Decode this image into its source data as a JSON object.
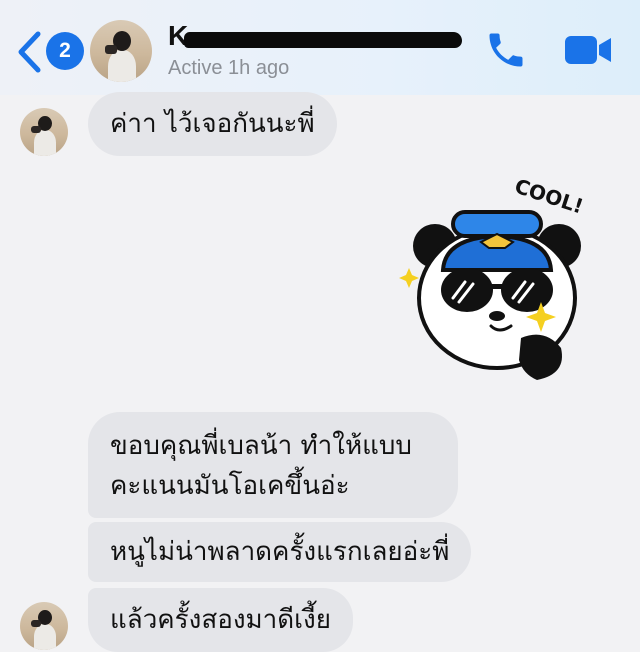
{
  "header": {
    "back_badge_count": "2",
    "contact_initial": "K",
    "status": "Active 1h ago"
  },
  "colors": {
    "accent": "#1a73e8",
    "bubble": "#e4e5e9",
    "background": "#f2f2f4",
    "status_text": "#8b8f96"
  },
  "icons": {
    "back": "chevron-left-icon",
    "call": "phone-icon",
    "video": "video-camera-icon",
    "sticker": "panda-sticker"
  },
  "sticker": {
    "caption": "COOL!"
  },
  "messages": [
    {
      "text": "ค่าา ไว้เจอกันนะพี่"
    },
    {
      "lines": [
        "ขอบคุณพี่เบลน้า  ทำให้แบบ",
        "คะแนนมันโอเคขึ้นอ่ะ"
      ]
    },
    {
      "text": "หนูไม่น่าพลาดครั้งแรกเลยอ่ะพี่"
    },
    {
      "text": "แล้วครั้งสองมาดีเงี้ย"
    }
  ]
}
